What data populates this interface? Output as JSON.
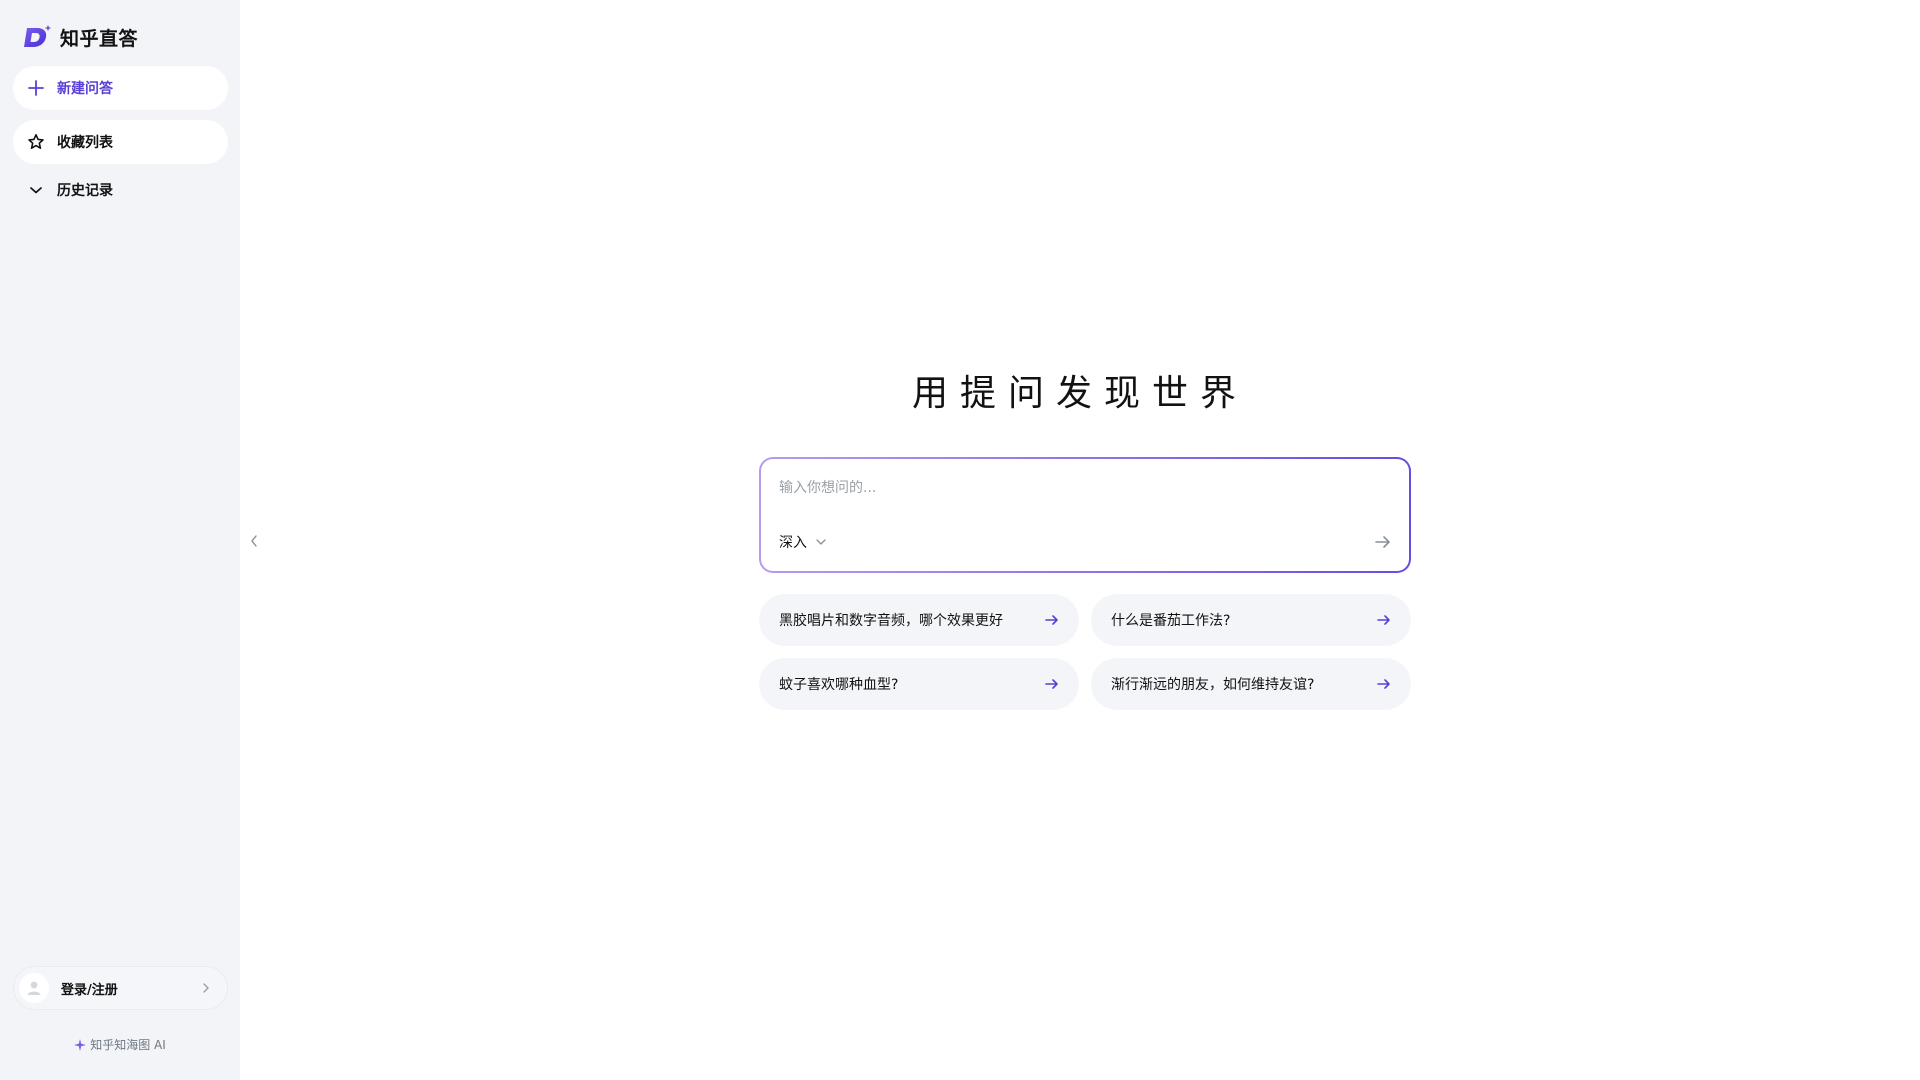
{
  "brand": {
    "name": "知乎直答",
    "logo_icon": "zhida-d-logo-icon",
    "accent": "#5a3fd6"
  },
  "sidebar": {
    "new_chat": {
      "label": "新建问答",
      "icon": "plus-icon"
    },
    "favorites": {
      "label": "收藏列表",
      "icon": "star-icon"
    },
    "history": {
      "label": "历史记录",
      "icon": "chevron-down-icon"
    }
  },
  "account": {
    "login_label": "登录/注册",
    "icon": "user-icon"
  },
  "footer": {
    "powered_by": "知乎知海图 AI"
  },
  "main": {
    "headline": "用提问发现世界",
    "ask": {
      "placeholder": "输入你想问的...",
      "value": "",
      "mode": "深入"
    },
    "suggestions": [
      "黑胶唱片和数字音频，哪个效果更好",
      "什么是番茄工作法?",
      "蚊子喜欢哪种血型?",
      "渐行渐远的朋友，如何维持友谊?"
    ]
  },
  "colors": {
    "sidebar_bg": "#f2f4f8",
    "accent": "#5a3fd6",
    "border_gradient_start": "#b79af0",
    "border_gradient_end": "#6a4be0"
  }
}
